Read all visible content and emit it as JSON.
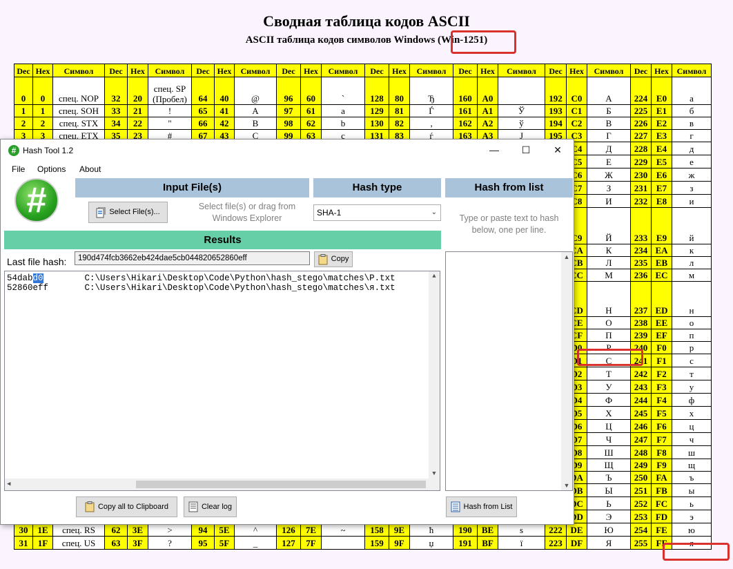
{
  "document": {
    "title": "Сводная таблица кодов ASCII",
    "subtitle": "ASCII таблица кодов символов Windows (Win-1251)",
    "headers": [
      "Dec",
      "Hex",
      "Символ",
      "Dec",
      "Hex",
      "Символ",
      "Dec",
      "Hex",
      "Символ",
      "Dec",
      "Hex",
      "Символ",
      "Dec",
      "Hex",
      "Символ",
      "Dec",
      "Hex",
      "Символ",
      "Dec",
      "Hex",
      "Символ",
      "Dec",
      "Hex",
      "Символ"
    ],
    "rows_top": [
      [
        "0",
        "0",
        "спец. NOP",
        "32",
        "20",
        "спец. SP (Пробел)",
        "64",
        "40",
        "@",
        "96",
        "60",
        "`",
        "128",
        "80",
        "Ђ",
        "160",
        "A0",
        "",
        "192",
        "C0",
        "А",
        "224",
        "E0",
        "а"
      ],
      [
        "1",
        "1",
        "спец. SOH",
        "33",
        "21",
        "!",
        "65",
        "41",
        "A",
        "97",
        "61",
        "a",
        "129",
        "81",
        "Ѓ",
        "161",
        "A1",
        "Ў",
        "193",
        "C1",
        "Б",
        "225",
        "E1",
        "б"
      ],
      [
        "2",
        "2",
        "спец. STX",
        "34",
        "22",
        "\"",
        "66",
        "42",
        "B",
        "98",
        "62",
        "b",
        "130",
        "82",
        "‚",
        "162",
        "A2",
        "ў",
        "194",
        "C2",
        "В",
        "226",
        "E2",
        "в"
      ],
      [
        "3",
        "3",
        "спец. ETX",
        "35",
        "23",
        "#",
        "67",
        "43",
        "C",
        "99",
        "63",
        "c",
        "131",
        "83",
        "ѓ",
        "163",
        "A3",
        "Ј",
        "195",
        "C3",
        "Г",
        "227",
        "E3",
        "г"
      ]
    ],
    "rows_right": [
      [
        "C4",
        "Д",
        "228",
        "E4",
        "д"
      ],
      [
        "C5",
        "Е",
        "229",
        "E5",
        "е"
      ],
      [
        "C6",
        "Ж",
        "230",
        "E6",
        "ж"
      ],
      [
        "C7",
        "З",
        "231",
        "E7",
        "з"
      ],
      [
        "C8",
        "И",
        "232",
        "E8",
        "и"
      ],
      [
        "C9",
        "Й",
        "233",
        "E9",
        "й"
      ],
      [
        "CA",
        "К",
        "234",
        "EA",
        "к"
      ],
      [
        "CB",
        "Л",
        "235",
        "EB",
        "л"
      ],
      [
        "CC",
        "М",
        "236",
        "EC",
        "м"
      ],
      [
        "CD",
        "Н",
        "237",
        "ED",
        "н"
      ],
      [
        "CE",
        "О",
        "238",
        "EE",
        "о"
      ],
      [
        "CF",
        "П",
        "239",
        "EF",
        "п"
      ],
      [
        "D0",
        "Р",
        "240",
        "F0",
        "р"
      ],
      [
        "D1",
        "С",
        "241",
        "F1",
        "с"
      ],
      [
        "D2",
        "Т",
        "242",
        "F2",
        "т"
      ],
      [
        "D3",
        "У",
        "243",
        "F3",
        "у"
      ],
      [
        "D4",
        "Ф",
        "244",
        "F4",
        "ф"
      ],
      [
        "D5",
        "Х",
        "245",
        "F5",
        "х"
      ],
      [
        "D6",
        "Ц",
        "246",
        "F6",
        "ц"
      ],
      [
        "D7",
        "Ч",
        "247",
        "F7",
        "ч"
      ],
      [
        "D8",
        "Ш",
        "248",
        "F8",
        "ш"
      ],
      [
        "D9",
        "Щ",
        "249",
        "F9",
        "щ"
      ],
      [
        "DA",
        "Ъ",
        "250",
        "FA",
        "ъ"
      ],
      [
        "DB",
        "Ы",
        "251",
        "FB",
        "ы"
      ],
      [
        "DC",
        "Ь",
        "252",
        "FC",
        "ь"
      ],
      [
        "DD",
        "Э",
        "253",
        "FD",
        "э"
      ]
    ],
    "rows_bottom": [
      [
        "30",
        "1E",
        "спец. RS",
        "62",
        "3E",
        ">",
        "94",
        "5E",
        "^",
        "126",
        "7E",
        "~",
        "158",
        "9E",
        "ћ",
        "190",
        "BE",
        "ѕ",
        "222",
        "DE",
        "Ю",
        "254",
        "FE",
        "ю"
      ],
      [
        "31",
        "1F",
        "спец. US",
        "63",
        "3F",
        "?",
        "95",
        "5F",
        "_",
        "127",
        "7F",
        "",
        "159",
        "9F",
        "џ",
        "191",
        "BF",
        "ї",
        "223",
        "DF",
        "Я",
        "255",
        "FF",
        "я"
      ]
    ]
  },
  "window": {
    "title": "Hash Tool 1.2",
    "controls": {
      "minimize": "—",
      "maximize": "☐",
      "close": "✕"
    },
    "menu": [
      "File",
      "Options",
      "About"
    ],
    "logo": "#",
    "input_panel": {
      "header": "Input File(s)",
      "select_button": "Select File(s)...",
      "hint_line1": "Select file(s) or drag from",
      "hint_line2": "Windows Explorer"
    },
    "hash_panel": {
      "header": "Hash type",
      "selected": "SHA-1"
    },
    "list_panel": {
      "header": "Hash from list",
      "hint_line1": "Type or paste text to hash",
      "hint_line2": "below, one per line."
    },
    "results": {
      "header": "Results",
      "last_hash_label": "Last file hash:",
      "last_hash_value": "190d474fcb3662eb424dae5cb044820652860eff",
      "copy_button": "Copy",
      "log": [
        {
          "prefix": "54dab",
          "highlight": "d0",
          "path": "        C:\\Users\\Hikari\\Desktop\\Code\\Python\\hash_stego\\matches\\Р.txt"
        },
        {
          "prefix": "52860",
          "highlight": "eff",
          "path": "       C:\\Users\\Hikari\\Desktop\\Code\\Python\\hash_stego\\matches\\я.txt"
        }
      ]
    },
    "buttons": {
      "copy_all": "Copy all to Clipboard",
      "clear_log": "Clear log",
      "hash_from_list": "Hash from List"
    },
    "accent": {
      "panel_header": "#a9c3da",
      "results_header": "#66cfa8",
      "highlight_box": "#d9312d"
    }
  }
}
